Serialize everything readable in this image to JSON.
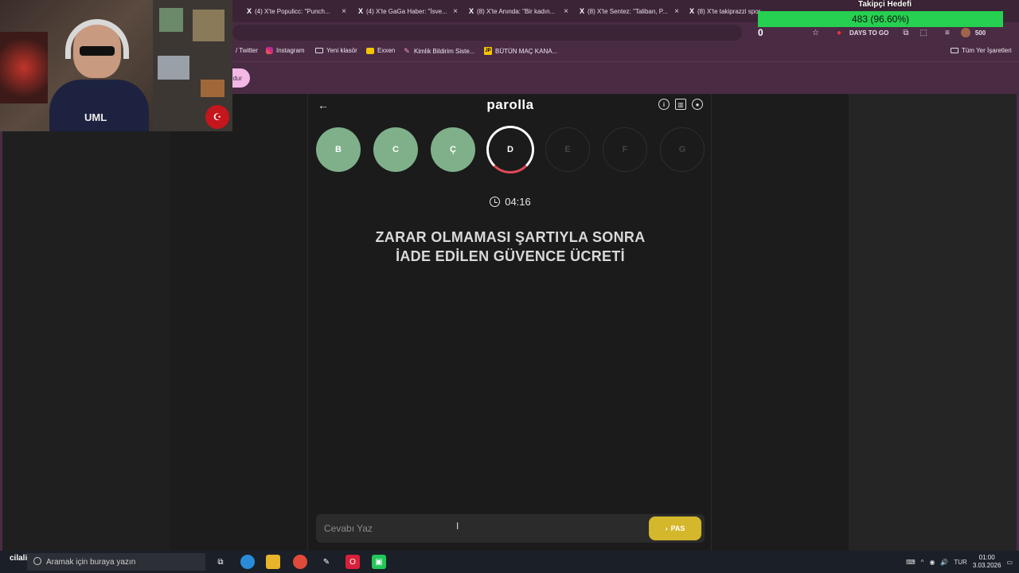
{
  "tabs": [
    {
      "title": "(4) X'te Populicc: \"Punch..."
    },
    {
      "title": "(4) X'te GaGa Haber: \"İsve..."
    },
    {
      "title": "(8) X'te Anında: \"Bir kadın..."
    },
    {
      "title": "(8) X'te Sentez: \"Taliban, P..."
    },
    {
      "title": "(8) X'te takiprazzi spor..."
    }
  ],
  "bookmarks": [
    {
      "label": "/ Twitter",
      "icon": "twitter-icon"
    },
    {
      "label": "Instagram",
      "icon": "instagram-icon"
    },
    {
      "label": "Yeni klasör",
      "icon": "folder-icon"
    },
    {
      "label": "Exxen",
      "icon": "exxen-icon"
    },
    {
      "label": "Kimlik Bildirim Siste...",
      "icon": "link-icon"
    },
    {
      "label": "BÜTÜN MAÇ KANA...",
      "icon": "jp-icon"
    }
  ],
  "bookmarks_all": "Tüm Yer İşaretleri",
  "page_pill": "dur",
  "toolbar": {
    "days_to_go": "DAYS TO GO",
    "counter_right": "500"
  },
  "overlay": {
    "follow_title": "Takipçi Hedefi",
    "follow_progress": "483 (96.60%)",
    "follow_progress_fraction": 0.966,
    "zero_counter": "0",
    "accent": "#26d050"
  },
  "webcam": {
    "shirt_text": "UML",
    "flag_symbol": "☪"
  },
  "game": {
    "logo": "parolla",
    "letters": [
      {
        "char": "B",
        "state": "done"
      },
      {
        "char": "C",
        "state": "done"
      },
      {
        "char": "Ç",
        "state": "done"
      },
      {
        "char": "D",
        "state": "active"
      },
      {
        "char": "E",
        "state": "pending"
      },
      {
        "char": "F",
        "state": "pending"
      },
      {
        "char": "G",
        "state": "pending"
      }
    ],
    "timer": "04:16",
    "question_line1": "ZARAR OLMAMASI ŞARTIYLA SONRA",
    "question_line2": "İADE EDİLEN GÜVENCE ÜCRETİ",
    "answer_placeholder": "Cevabı Yaz",
    "pass_label": "PAS",
    "colors": {
      "done": "#7fb08a",
      "active_ring": "#e24a56",
      "pass": "#d4b72a"
    }
  },
  "taskbar": {
    "corner_label": "cilali",
    "search_placeholder": "Aramak için buraya yazın",
    "lang": "TUR",
    "time": "01:00",
    "date": "3.03.2026"
  }
}
